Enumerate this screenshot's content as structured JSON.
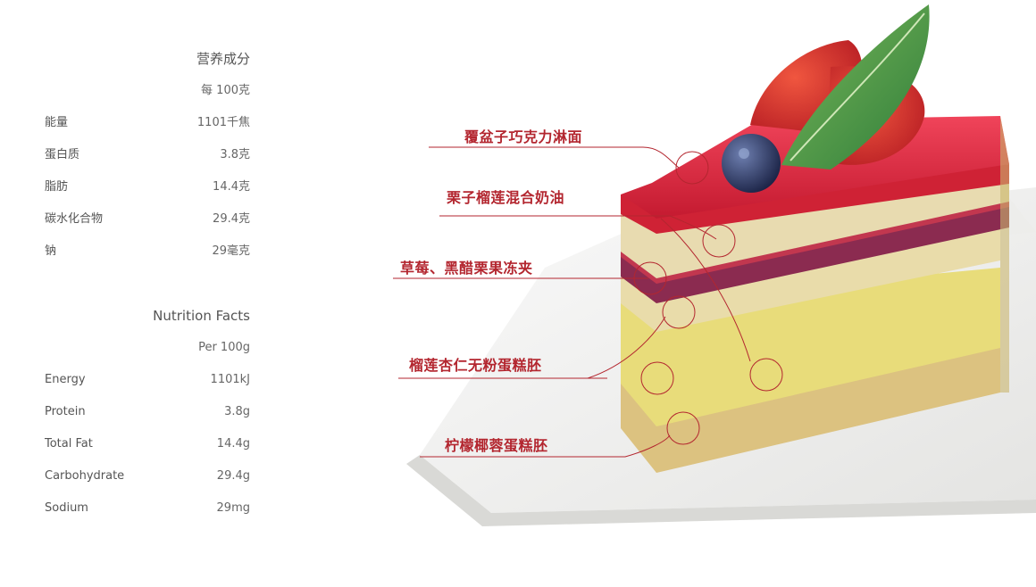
{
  "nutrition_cn": {
    "title": "营养成分",
    "per": "每 100克",
    "rows": [
      {
        "name": "能量",
        "value": "1101千焦"
      },
      {
        "name": "蛋白质",
        "value": "3.8克"
      },
      {
        "name": "脂肪",
        "value": "14.4克"
      },
      {
        "name": "碳水化合物",
        "value": "29.4克"
      },
      {
        "name": "钠",
        "value": "29毫克"
      }
    ]
  },
  "nutrition_en": {
    "title": "Nutrition Facts",
    "per": "Per 100g",
    "rows": [
      {
        "name": "Energy",
        "value": "1101kJ"
      },
      {
        "name": "Protein",
        "value": "3.8g"
      },
      {
        "name": "Total Fat",
        "value": "14.4g"
      },
      {
        "name": "Carbohydrate",
        "value": "29.4g"
      },
      {
        "name": "Sodium",
        "value": "29mg"
      }
    ]
  },
  "layers": [
    {
      "label": "覆盆子巧克力淋面"
    },
    {
      "label": "栗子榴莲混合奶油"
    },
    {
      "label": "草莓、黑醋栗果冻夹"
    },
    {
      "label": "榴莲杏仁无粉蛋糕胚"
    },
    {
      "label": "柠檬椰蓉蛋糕胚"
    }
  ],
  "colors": {
    "accent": "#b3262f",
    "glaze": "#d8263a",
    "cream": "#e9dca6",
    "jelly": "#8a2a4e",
    "sponge": "#e6d878",
    "base": "#dcc280",
    "plate": "#f2f2f0"
  }
}
